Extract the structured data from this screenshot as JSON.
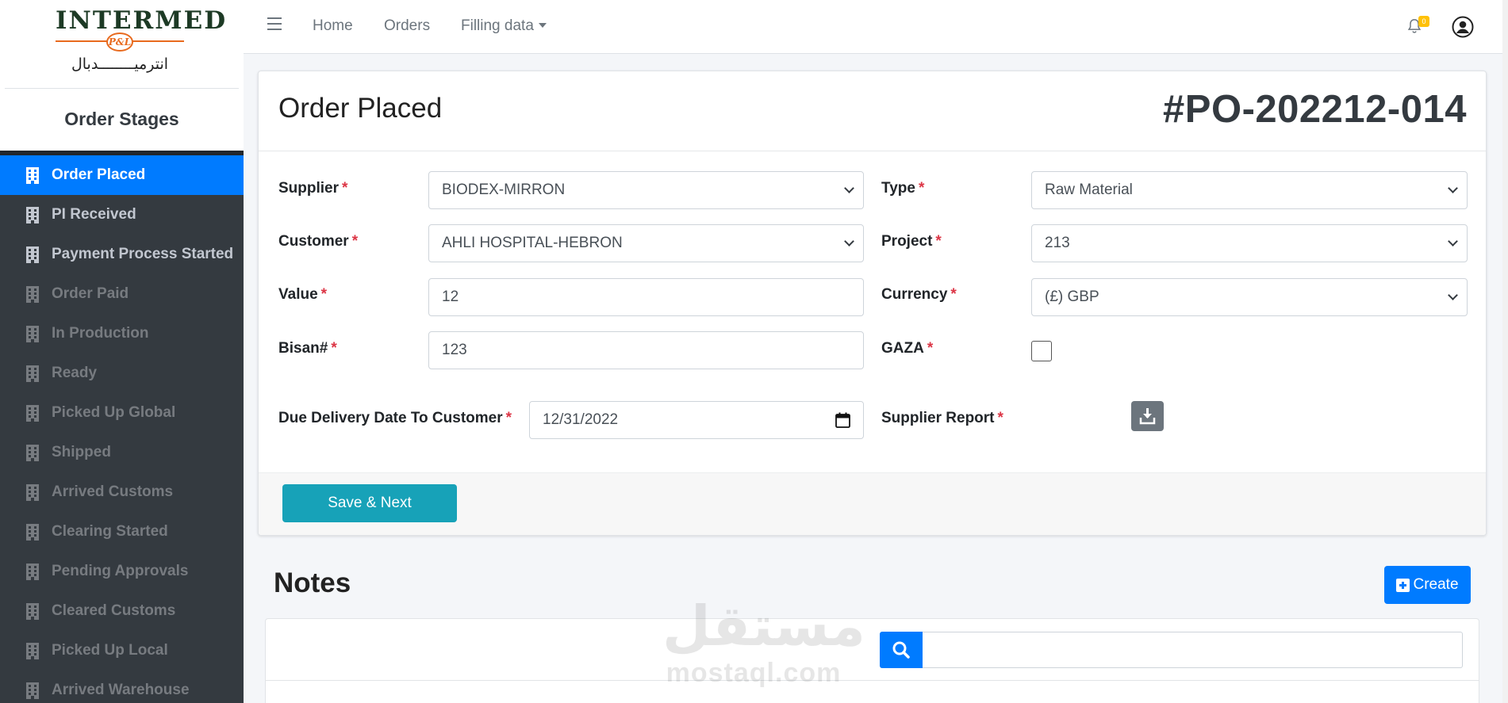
{
  "brand": {
    "logo_text": "INTERMED",
    "logo_emblem": "P&L",
    "logo_arabic": "انترميــــــــدبال"
  },
  "sidebar": {
    "title": "Order Stages",
    "items": [
      {
        "label": "Order Placed",
        "icon": "building-icon",
        "state": "active"
      },
      {
        "label": "PI Received",
        "icon": "building-icon",
        "state": "enabled"
      },
      {
        "label": "Payment Process Started",
        "icon": "building-icon",
        "state": "enabled"
      },
      {
        "label": "Order Paid",
        "icon": "building-icon",
        "state": "disabled"
      },
      {
        "label": "In Production",
        "icon": "building-icon",
        "state": "disabled"
      },
      {
        "label": "Ready",
        "icon": "building-icon",
        "state": "disabled"
      },
      {
        "label": "Picked Up Global",
        "icon": "building-icon",
        "state": "disabled"
      },
      {
        "label": "Shipped",
        "icon": "building-icon",
        "state": "disabled"
      },
      {
        "label": "Arrived Customs",
        "icon": "building-icon",
        "state": "disabled"
      },
      {
        "label": "Clearing Started",
        "icon": "building-icon",
        "state": "disabled"
      },
      {
        "label": "Pending Approvals",
        "icon": "building-icon",
        "state": "disabled"
      },
      {
        "label": "Cleared Customs",
        "icon": "building-icon",
        "state": "disabled"
      },
      {
        "label": "Picked Up Local",
        "icon": "building-icon",
        "state": "disabled"
      },
      {
        "label": "Arrived Warehouse",
        "icon": "building-icon",
        "state": "disabled"
      }
    ]
  },
  "topnav": {
    "links": [
      "Home",
      "Orders",
      "Filling data"
    ],
    "notification_count": "0"
  },
  "form": {
    "title": "Order Placed",
    "po_number": "#PO-202212-014",
    "required_mark": "*",
    "supplier": {
      "label": "Supplier",
      "value": "BIODEX-MIRRON"
    },
    "type": {
      "label": "Type",
      "value": "Raw Material"
    },
    "customer": {
      "label": "Customer",
      "value": "AHLI HOSPITAL-HEBRON"
    },
    "project": {
      "label": "Project",
      "value": "213"
    },
    "value": {
      "label": "Value",
      "value": "12"
    },
    "currency": {
      "label": "Currency",
      "value": "(£) GBP"
    },
    "bisan": {
      "label": "Bisan#",
      "value": "123"
    },
    "gaza": {
      "label": "GAZA",
      "checked": false
    },
    "due_date": {
      "label": "Due Delivery Date To Customer",
      "value": "12/31/2022"
    },
    "supplier_report": {
      "label": "Supplier Report"
    },
    "save_label": "Save & Next"
  },
  "notes": {
    "title": "Notes",
    "create_label": "Create",
    "search_value": ""
  },
  "watermark": {
    "arabic": "مستقل",
    "latin": "mostaql.com"
  },
  "colors": {
    "primary": "#007bff",
    "info": "#17a2b8",
    "sidebar": "#343a40",
    "required": "#dc3545",
    "badge": "#ffc107"
  }
}
